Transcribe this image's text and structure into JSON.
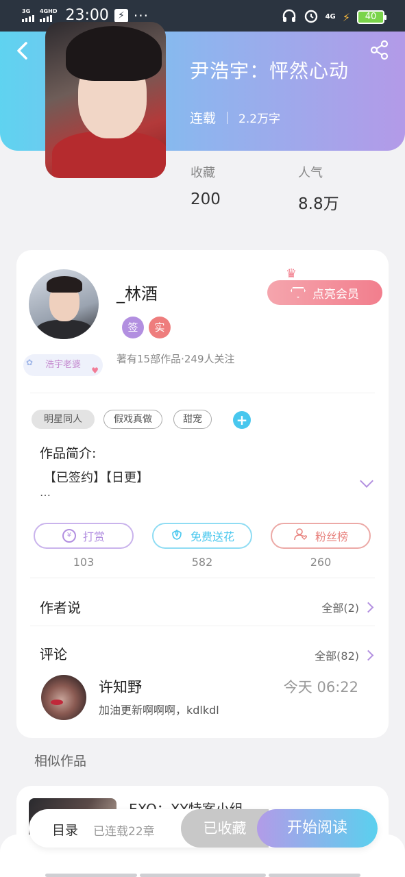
{
  "status_bar": {
    "signal1": "3G",
    "signal2": "4GHD",
    "time": "23:00",
    "dots": "···",
    "network": "4G",
    "battery": "40"
  },
  "header": {
    "title": "尹浩宇：怦然心动",
    "status": "连载",
    "word_count": "2.2万字",
    "stats": [
      {
        "label": "收藏",
        "value": "200"
      },
      {
        "label": "人气",
        "value": "8.8万"
      }
    ]
  },
  "author": {
    "name": "_林酒",
    "badge_sign": "签",
    "badge_real": "实",
    "fan_badge": "浩宇老婆",
    "info": "著有15部作品·249人关注",
    "vip_button": "点亮会员"
  },
  "tags": [
    "明星同人",
    "假戏真做",
    "甜宠"
  ],
  "intro": {
    "label": "作品简介:",
    "text": "【已签约】【日更】",
    "more": "…"
  },
  "actions": [
    {
      "label": "打赏",
      "count": "103",
      "icon": "yen-icon",
      "color": "#b28fe0"
    },
    {
      "label": "免费送花",
      "count": "582",
      "icon": "flower-icon",
      "color": "#48c7ee"
    },
    {
      "label": "粉丝榜",
      "count": "260",
      "icon": "fan-rank-icon",
      "color": "#e8837f"
    }
  ],
  "author_says": {
    "title": "作者说",
    "link": "全部(2)"
  },
  "comments": {
    "title": "评论",
    "link": "全部(82)",
    "items": [
      {
        "user": "许知野",
        "time": "今天 06:22",
        "text": "加油更新啊啊啊，kdlkdl"
      }
    ]
  },
  "similar": {
    "title": "相似作品",
    "items": [
      {
        "title": "EXO：XY特案小组"
      }
    ]
  },
  "bottom_bar": {
    "catalog": "目录",
    "chapters": "已连载22章",
    "collected": "已收藏",
    "read": "开始阅读"
  },
  "colors": {
    "accent_purple": "#b28fe0",
    "accent_blue": "#48c7ee",
    "vip_pink": "#f27e8d"
  }
}
